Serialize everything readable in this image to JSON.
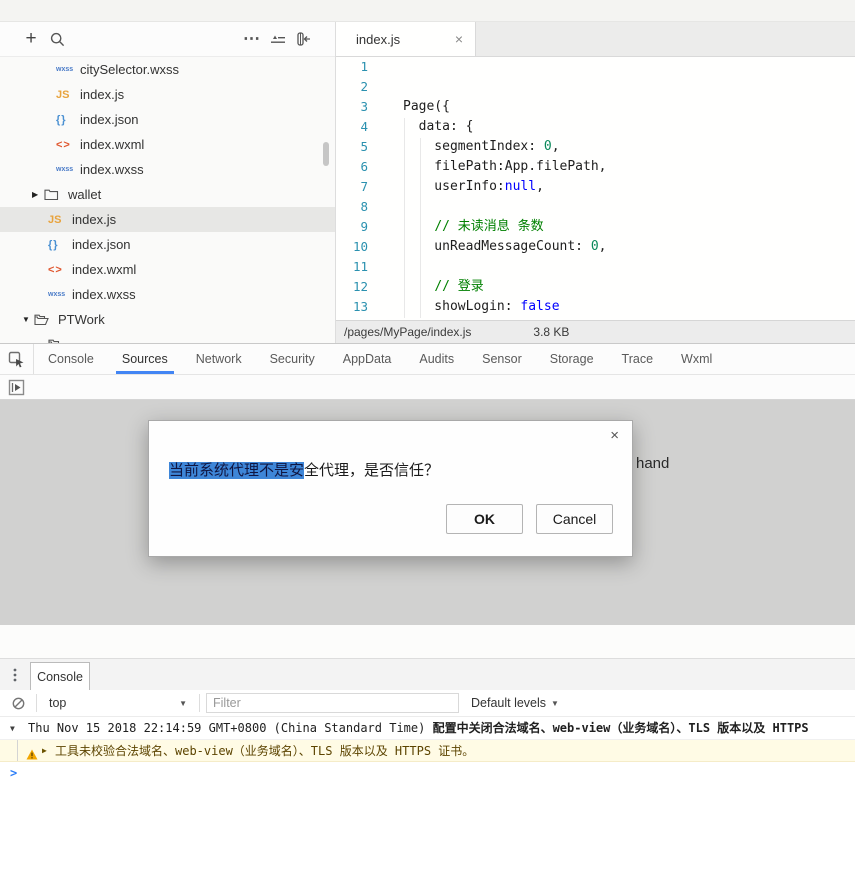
{
  "colors": {
    "accent_blue": "#4285f4",
    "selection_bg": "#3e86d8",
    "warning_bg": "#fffbe5",
    "stage_gray": "#d1d1d0"
  },
  "sidebar": {
    "toolbar": {
      "plus_glyph": "+",
      "more_glyph": "⋯",
      "icons": [
        "add-file",
        "search",
        "more",
        "scroll-to-top",
        "collapse-sidebar"
      ]
    },
    "tree": {
      "items": [
        {
          "icon": "wxss",
          "badge": "wxss",
          "label": "citySelector.wxss",
          "indent": 56,
          "arrow": "",
          "selected": false
        },
        {
          "icon": "js",
          "badge": "JS",
          "label": "index.js",
          "indent": 56,
          "arrow": "",
          "selected": false
        },
        {
          "icon": "json",
          "badge": "{}",
          "label": "index.json",
          "indent": 56,
          "arrow": "",
          "selected": false
        },
        {
          "icon": "wxml",
          "badge": "<>",
          "label": "index.wxml",
          "indent": 56,
          "arrow": "",
          "selected": false
        },
        {
          "icon": "wxss",
          "badge": "wxss",
          "label": "index.wxss",
          "indent": 56,
          "arrow": "",
          "selected": false
        },
        {
          "icon": "folder",
          "badge": "",
          "label": "wallet",
          "indent": 32,
          "arrow": "collapsed",
          "selected": false
        },
        {
          "icon": "js",
          "badge": "JS",
          "label": "index.js",
          "indent": 48,
          "arrow": "",
          "selected": true
        },
        {
          "icon": "json",
          "badge": "{}",
          "label": "index.json",
          "indent": 48,
          "arrow": "",
          "selected": false
        },
        {
          "icon": "wxml",
          "badge": "<>",
          "label": "index.wxml",
          "indent": 48,
          "arrow": "",
          "selected": false
        },
        {
          "icon": "wxss",
          "badge": "wxss",
          "label": "index.wxss",
          "indent": 48,
          "arrow": "",
          "selected": false
        },
        {
          "icon": "folder-open",
          "badge": "",
          "label": "PTWork",
          "indent": 22,
          "arrow": "expanded",
          "selected": false
        },
        {
          "icon": "folder-open",
          "badge": "",
          "label": "",
          "indent": 48,
          "arrow": "",
          "selected": false
        }
      ]
    }
  },
  "editor": {
    "tab": {
      "label": "index.js",
      "close": "×"
    },
    "code": {
      "lines": [
        {
          "n": "1",
          "segs": []
        },
        {
          "n": "2",
          "segs": []
        },
        {
          "n": "3",
          "segs": [
            {
              "t": "Page({",
              "c": "plain"
            }
          ]
        },
        {
          "n": "4",
          "segs": [
            {
              "t": "  data: {",
              "c": "plain"
            }
          ]
        },
        {
          "n": "5",
          "segs": [
            {
              "t": "    segmentIndex: ",
              "c": "plain"
            },
            {
              "t": "0",
              "c": "num"
            },
            {
              "t": ",",
              "c": "plain"
            }
          ]
        },
        {
          "n": "6",
          "segs": [
            {
              "t": "    filePath:App.filePath,",
              "c": "plain"
            }
          ]
        },
        {
          "n": "7",
          "segs": [
            {
              "t": "    userInfo:",
              "c": "plain"
            },
            {
              "t": "null",
              "c": "kw"
            },
            {
              "t": ",",
              "c": "plain"
            }
          ]
        },
        {
          "n": "8",
          "segs": []
        },
        {
          "n": "9",
          "segs": [
            {
              "t": "    ",
              "c": "plain"
            },
            {
              "t": "// 未读消息 条数",
              "c": "comment"
            }
          ]
        },
        {
          "n": "10",
          "segs": [
            {
              "t": "    unReadMessageCount: ",
              "c": "plain"
            },
            {
              "t": "0",
              "c": "num"
            },
            {
              "t": ",",
              "c": "plain"
            }
          ]
        },
        {
          "n": "11",
          "segs": []
        },
        {
          "n": "12",
          "segs": [
            {
              "t": "    ",
              "c": "plain"
            },
            {
              "t": "// 登录",
              "c": "comment"
            }
          ]
        },
        {
          "n": "13",
          "segs": [
            {
              "t": "    showLogin: ",
              "c": "plain"
            },
            {
              "t": "false",
              "c": "kw"
            }
          ]
        }
      ]
    },
    "status": {
      "path": "/pages/MyPage/index.js",
      "size": "3.8 KB"
    }
  },
  "devtools": {
    "tabs": [
      {
        "label": "Console",
        "active": false
      },
      {
        "label": "Sources",
        "active": true
      },
      {
        "label": "Network",
        "active": false
      },
      {
        "label": "Security",
        "active": false
      },
      {
        "label": "AppData",
        "active": false
      },
      {
        "label": "Audits",
        "active": false
      },
      {
        "label": "Sensor",
        "active": false
      },
      {
        "label": "Storage",
        "active": false
      },
      {
        "label": "Trace",
        "active": false
      },
      {
        "label": "Wxml",
        "active": false
      }
    ]
  },
  "stage": {
    "partial_text": "hand"
  },
  "dialog": {
    "message_selected": "当前系统代理不是安",
    "message_rest": "全代理，是否信任？",
    "ok_label": "OK",
    "cancel_label": "Cancel",
    "close": "×"
  },
  "console_panel": {
    "tab_label": "Console",
    "context_selector": "top",
    "filter_placeholder": "Filter",
    "levels_label": "Default levels",
    "log_group": {
      "timestamp": "Thu Nov 15 2018 22:14:59 GMT+0800 (China Standard Time) ",
      "message": "配置中关闭合法域名、web-view（业务域名）、TLS 版本以及 HTTPS"
    },
    "warning_text": "工具未校验合法域名、web-view（业务域名）、TLS 版本以及 HTTPS 证书。",
    "prompt": ">"
  }
}
